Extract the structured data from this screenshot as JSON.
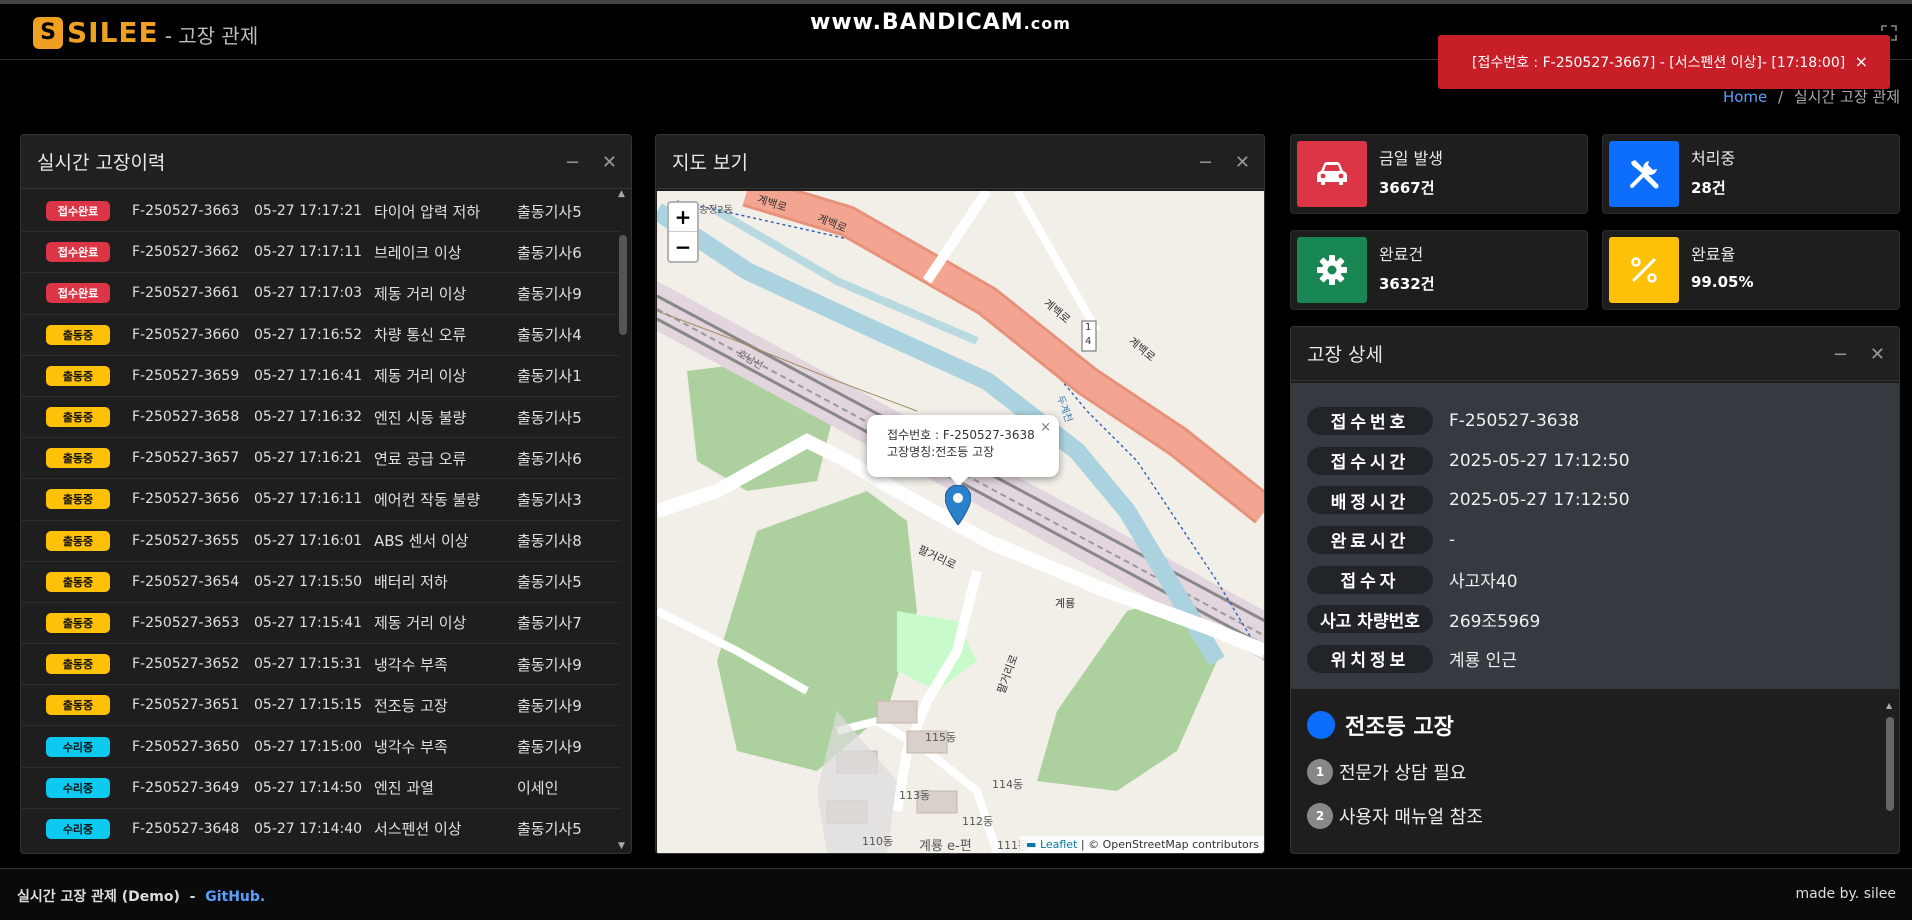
{
  "header": {
    "logo_letter": "S",
    "brand": "SILEE",
    "subtitle": "- 고장 관제",
    "watermark_main": "www.BANDICAM",
    "watermark_tld": ".com"
  },
  "breadcrumb": {
    "home": "Home",
    "separator": "/",
    "current": "실시간 고장 관제"
  },
  "toast": {
    "message": "[접수번호 : F-250527-3667] - [서스펜션 이상]- [17:18:00]",
    "close": "×"
  },
  "history": {
    "title": "실시간 고장이력",
    "rows": [
      {
        "status": "접수완료",
        "color": "red",
        "id": "F-250527-3663",
        "time": "05-27 17:17:21",
        "desc": "타이어 압력 저하",
        "engineer": "출동기사5"
      },
      {
        "status": "접수완료",
        "color": "red",
        "id": "F-250527-3662",
        "time": "05-27 17:17:11",
        "desc": "브레이크 이상",
        "engineer": "출동기사6"
      },
      {
        "status": "접수완료",
        "color": "red",
        "id": "F-250527-3661",
        "time": "05-27 17:17:03",
        "desc": "제동 거리 이상",
        "engineer": "출동기사9"
      },
      {
        "status": "출동중",
        "color": "yellow",
        "id": "F-250527-3660",
        "time": "05-27 17:16:52",
        "desc": "차량 통신 오류",
        "engineer": "출동기사4"
      },
      {
        "status": "출동중",
        "color": "yellow",
        "id": "F-250527-3659",
        "time": "05-27 17:16:41",
        "desc": "제동 거리 이상",
        "engineer": "출동기사1"
      },
      {
        "status": "출동중",
        "color": "yellow",
        "id": "F-250527-3658",
        "time": "05-27 17:16:32",
        "desc": "엔진 시동 불량",
        "engineer": "출동기사5"
      },
      {
        "status": "출동중",
        "color": "yellow",
        "id": "F-250527-3657",
        "time": "05-27 17:16:21",
        "desc": "연료 공급 오류",
        "engineer": "출동기사6"
      },
      {
        "status": "출동중",
        "color": "yellow",
        "id": "F-250527-3656",
        "time": "05-27 17:16:11",
        "desc": "에어컨 작동 불량",
        "engineer": "출동기사3"
      },
      {
        "status": "출동중",
        "color": "yellow",
        "id": "F-250527-3655",
        "time": "05-27 17:16:01",
        "desc": "ABS 센서 이상",
        "engineer": "출동기사8"
      },
      {
        "status": "출동중",
        "color": "yellow",
        "id": "F-250527-3654",
        "time": "05-27 17:15:50",
        "desc": "배터리 저하",
        "engineer": "출동기사5"
      },
      {
        "status": "출동중",
        "color": "yellow",
        "id": "F-250527-3653",
        "time": "05-27 17:15:41",
        "desc": "제동 거리 이상",
        "engineer": "출동기사7"
      },
      {
        "status": "출동중",
        "color": "yellow",
        "id": "F-250527-3652",
        "time": "05-27 17:15:31",
        "desc": "냉각수 부족",
        "engineer": "출동기사9"
      },
      {
        "status": "출동중",
        "color": "yellow",
        "id": "F-250527-3651",
        "time": "05-27 17:15:15",
        "desc": "전조등 고장",
        "engineer": "출동기사9"
      },
      {
        "status": "수리중",
        "color": "cyan",
        "id": "F-250527-3650",
        "time": "05-27 17:15:00",
        "desc": "냉각수 부족",
        "engineer": "출동기사9"
      },
      {
        "status": "수리중",
        "color": "cyan",
        "id": "F-250527-3649",
        "time": "05-27 17:14:50",
        "desc": "엔진 과열",
        "engineer": "이세인"
      },
      {
        "status": "수리중",
        "color": "cyan",
        "id": "F-250527-3648",
        "time": "05-27 17:14:40",
        "desc": "서스펜션 이상",
        "engineer": "출동기사5"
      }
    ]
  },
  "map": {
    "title": "지도 보기",
    "zoom_in": "+",
    "zoom_out": "−",
    "popup_line1": "접수번호 : F-250527-3638",
    "popup_line2": "고장명칭:전조등 고장",
    "popup_close": "×",
    "labels": {
      "songjeong": "송정2동",
      "gyebaekro": "계백로",
      "route14_a": "1",
      "route14_b": "4",
      "hoseonseon": "호남선",
      "daejeoncheon": "두계천",
      "palgeoriro": "팔거리로",
      "gyeryong": "계룡",
      "apt115": "115동",
      "apt114": "114동",
      "apt113": "113동",
      "apt112": "112동",
      "apt111": "111동",
      "apt110": "110동",
      "gyeryong_e_pyeon": "계룡 e-편"
    },
    "attribution_leaflet": "Leaflet",
    "attribution_rest": " | © OpenStreetMap contributors"
  },
  "stats": [
    {
      "label": "금일 발생",
      "value": "3667건",
      "color": "#dc3545",
      "icon": "car-icon"
    },
    {
      "label": "처리중",
      "value": "28건",
      "color": "#0d6efd",
      "icon": "tools-icon"
    },
    {
      "label": "완료건",
      "value": "3632건",
      "color": "#198754",
      "icon": "gear-icon"
    },
    {
      "label": "완료율",
      "value": "99.05%",
      "color": "#ffc107",
      "icon": "percent-icon"
    }
  ],
  "detail": {
    "title": "고장 상세",
    "fields": [
      {
        "label": "접수번호",
        "value": "F-250527-3638"
      },
      {
        "label": "접수시간",
        "value": "2025-05-27 17:12:50"
      },
      {
        "label": "배정시간",
        "value": "2025-05-27 17:12:50"
      },
      {
        "label": "완료시간",
        "value": "-"
      },
      {
        "label": "접수자",
        "value": "사고자40"
      },
      {
        "label": "사고 차량번호",
        "value": "269조5969"
      },
      {
        "label": "위치정보",
        "value": "계룡 인근"
      }
    ],
    "guide_title": "전조등 고장",
    "guide_color": "#0d6efd",
    "steps": [
      {
        "num": "1",
        "text": "전문가 상담 필요"
      },
      {
        "num": "2",
        "text": "사용자 매뉴얼 참조"
      }
    ]
  },
  "footer": {
    "left_text": "실시간 고장 관제 (Demo)  -  ",
    "github": "GitHub.",
    "right_text": "made by. silee"
  }
}
